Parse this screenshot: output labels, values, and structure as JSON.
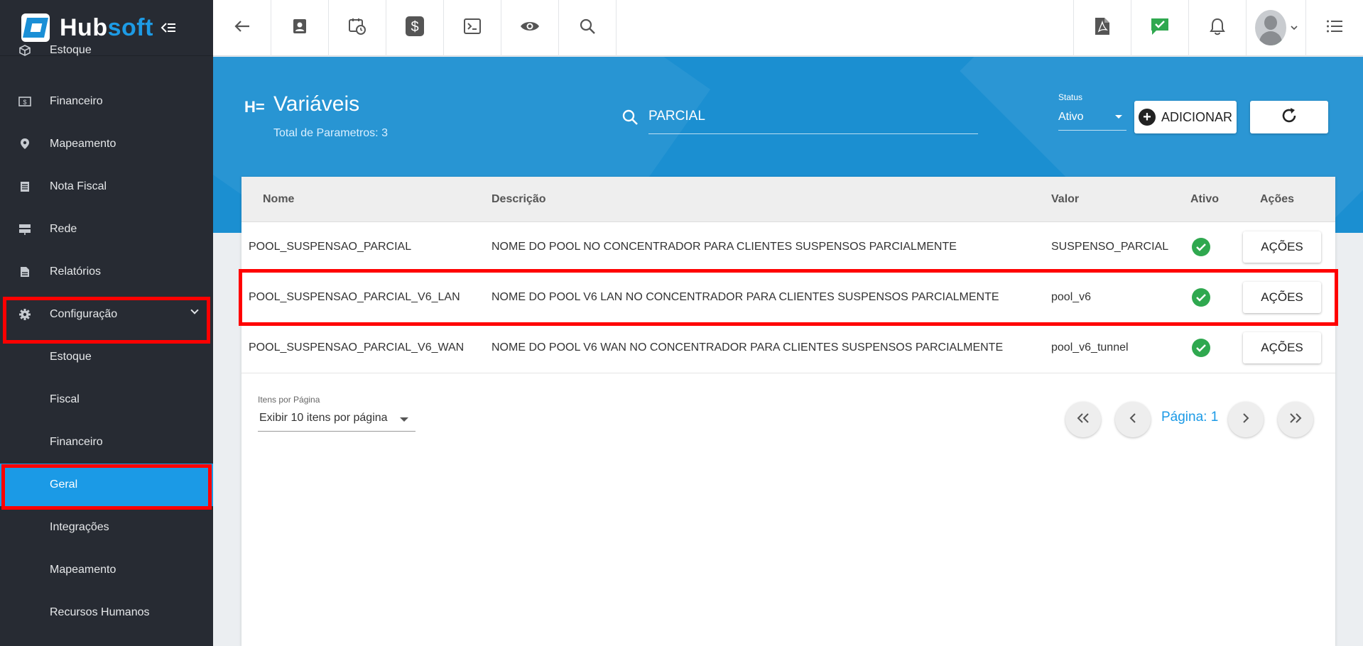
{
  "app": {
    "brand_hub": "Hub",
    "brand_soft": "soft"
  },
  "sidebar": {
    "items": [
      {
        "label": "Estoque",
        "icon": "box-icon"
      },
      {
        "label": "Financeiro",
        "icon": "money-icon"
      },
      {
        "label": "Mapeamento",
        "icon": "map-pin-icon"
      },
      {
        "label": "Nota Fiscal",
        "icon": "document-icon"
      },
      {
        "label": "Rede",
        "icon": "server-icon"
      },
      {
        "label": "Relatórios",
        "icon": "report-icon"
      },
      {
        "label": "Configuração",
        "icon": "gear-icon",
        "expanded": true
      }
    ],
    "subitems": [
      {
        "label": "Estoque"
      },
      {
        "label": "Fiscal"
      },
      {
        "label": "Financeiro"
      },
      {
        "label": "Geral",
        "active": true
      },
      {
        "label": "Integrações"
      },
      {
        "label": "Mapeamento"
      },
      {
        "label": "Recursos Humanos"
      }
    ]
  },
  "topbar": {
    "left_icons": [
      "back-arrow-icon",
      "contact-card-icon",
      "calendar-clock-icon",
      "dollar-icon",
      "terminal-icon",
      "eye-icon",
      "search-icon"
    ],
    "right_icons": [
      "pdf-icon",
      "chat-check-icon",
      "bell-icon",
      "avatar",
      "list-icon"
    ]
  },
  "header": {
    "icon_text": "H=",
    "title": "Variáveis",
    "subtitle": "Total de Parametros: 3",
    "search_value": "PARCIAL",
    "status_label": "Status",
    "status_value": "Ativo",
    "add_label": "ADICIONAR"
  },
  "table": {
    "headers": {
      "nome": "Nome",
      "descricao": "Descrição",
      "valor": "Valor",
      "ativo": "Ativo",
      "acoes": "Ações"
    },
    "rows": [
      {
        "nome": "POOL_SUSPENSAO_PARCIAL",
        "descricao": "NOME DO POOL NO CONCENTRADOR PARA CLIENTES SUSPENSOS PARCIALMENTE",
        "valor": "SUSPENSO_PARCIAL",
        "ativo": true,
        "acoes": "AÇÕES"
      },
      {
        "nome": "POOL_SUSPENSAO_PARCIAL_V6_LAN",
        "descricao": "NOME DO POOL V6 LAN NO CONCENTRADOR PARA CLIENTES SUSPENSOS PARCIALMENTE",
        "valor": "pool_v6",
        "ativo": true,
        "acoes": "AÇÕES"
      },
      {
        "nome": "POOL_SUSPENSAO_PARCIAL_V6_WAN",
        "descricao": "NOME DO POOL V6 WAN NO CONCENTRADOR PARA CLIENTES SUSPENSOS PARCIALMENTE",
        "valor": "pool_v6_tunnel",
        "ativo": true,
        "acoes": "AÇÕES"
      }
    ]
  },
  "pagination": {
    "per_page_label": "Itens por Página",
    "per_page_value": "Exibir 10 itens por página",
    "page_label": "Página: 1"
  },
  "colors": {
    "accent": "#1b9ae6",
    "highlight": "#ff0000",
    "sidebar_bg": "#272b33",
    "success": "#2fa84f"
  }
}
